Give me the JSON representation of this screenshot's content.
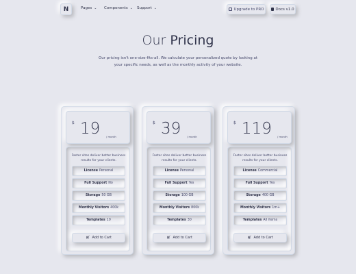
{
  "navbar": {
    "brand": "N",
    "menu": [
      {
        "label": "Pages"
      },
      {
        "label": "Components"
      },
      {
        "label": "Support"
      }
    ],
    "upgrade_label": "Upgrade to PRO",
    "docs_label": "Docs v1.0"
  },
  "hero": {
    "title_light": "Our",
    "title_bold": "Pricing",
    "subtitle": "Our pricing isn't one-size-fits-all. We calculate your personalized quote by looking at your specific needs, as well as the monthly activity of your website."
  },
  "plans": [
    {
      "currency": "$",
      "price": "19",
      "period": "/ month",
      "description": "Faster sites deliver better business results for your clients.",
      "features": [
        {
          "key": "License",
          "value": "Personal"
        },
        {
          "key": "Full Support",
          "value": "No"
        },
        {
          "key": "Storage",
          "value": "50 GB"
        },
        {
          "key": "Monthly Visitors",
          "value": "400k"
        },
        {
          "key": "Templates",
          "value": "10"
        }
      ],
      "cta": "Add to Cart"
    },
    {
      "currency": "$",
      "price": "39",
      "period": "/ month",
      "description": "Faster sites deliver better business results for your clients.",
      "features": [
        {
          "key": "License",
          "value": "Personal"
        },
        {
          "key": "Full Support",
          "value": "Yes"
        },
        {
          "key": "Storage",
          "value": "100 GB"
        },
        {
          "key": "Monthly Visitors",
          "value": "800k"
        },
        {
          "key": "Templates",
          "value": "30"
        }
      ],
      "cta": "Add to Cart"
    },
    {
      "currency": "$",
      "price": "119",
      "period": "/ month",
      "description": "Faster sites deliver better business results for your clients.",
      "features": [
        {
          "key": "License",
          "value": "Commercial"
        },
        {
          "key": "Full Support",
          "value": "Yes"
        },
        {
          "key": "Storage",
          "value": "400 GB"
        },
        {
          "key": "Monthly Visitors",
          "value": "1m+"
        },
        {
          "key": "Templates",
          "value": "All items"
        }
      ],
      "cta": "Add to Cart"
    }
  ],
  "colors": {
    "background": "#e6e7ee",
    "text": "#31344b",
    "muted": "#44476a"
  }
}
